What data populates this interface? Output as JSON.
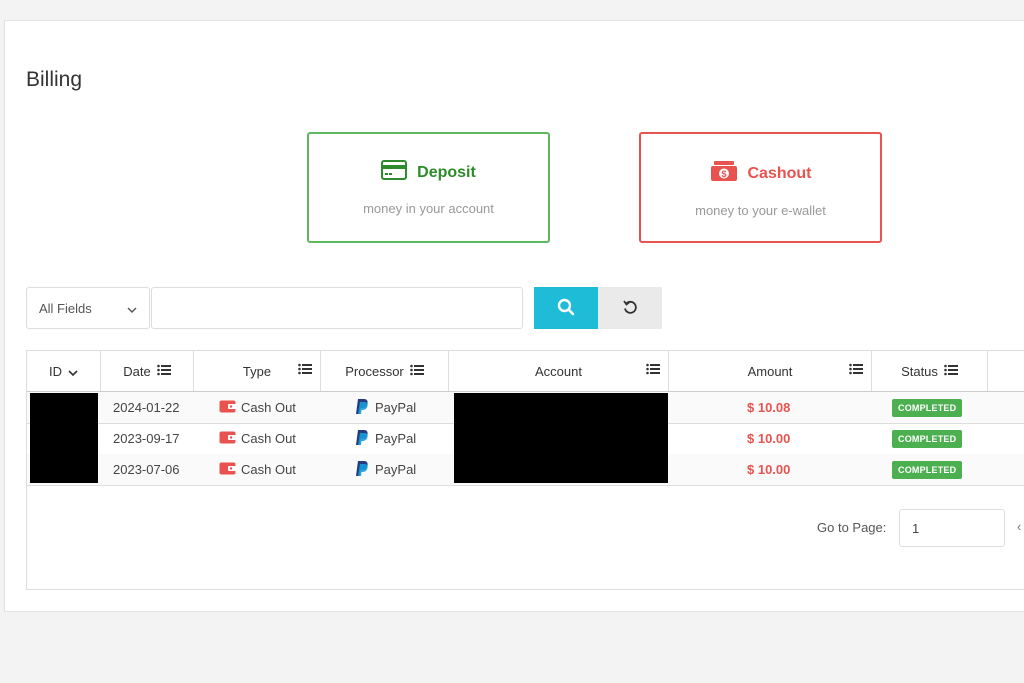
{
  "page": {
    "title": "Billing"
  },
  "actions": {
    "deposit": {
      "label": "Deposit",
      "subtitle": "money in your account",
      "color": "#2e8b2b"
    },
    "cashout": {
      "label": "Cashout",
      "subtitle": "money to your e-wallet",
      "color": "#e8524f"
    }
  },
  "search": {
    "field_selected": "All Fields",
    "query": "",
    "search_icon": "search-icon",
    "reset_icon": "reset-icon"
  },
  "table": {
    "columns": [
      {
        "label": "ID",
        "icon": "chevron-down-icon"
      },
      {
        "label": "Date",
        "icon": "list-icon"
      },
      {
        "label": "Type",
        "icon": "list-icon"
      },
      {
        "label": "Processor",
        "icon": "list-icon"
      },
      {
        "label": "Account",
        "icon": "list-icon"
      },
      {
        "label": "Amount",
        "icon": "list-icon"
      },
      {
        "label": "Status",
        "icon": "list-icon"
      }
    ],
    "rows": [
      {
        "date": "2024-01-22",
        "type": "Cash Out",
        "processor": "PayPal",
        "amount": "$ 10.08",
        "status": "COMPLETED"
      },
      {
        "date": "2023-09-17",
        "type": "Cash Out",
        "processor": "PayPal",
        "amount": "$ 10.00",
        "status": "COMPLETED"
      },
      {
        "date": "2023-07-06",
        "type": "Cash Out",
        "processor": "PayPal",
        "amount": "$ 10.00",
        "status": "COMPLETED"
      }
    ]
  },
  "pager": {
    "label": "Go to Page:",
    "value": "1",
    "prev_glyph": "‹"
  },
  "colors": {
    "search_button": "#1ebcd6",
    "status_completed": "#4caf50",
    "amount": "#e8524f"
  }
}
